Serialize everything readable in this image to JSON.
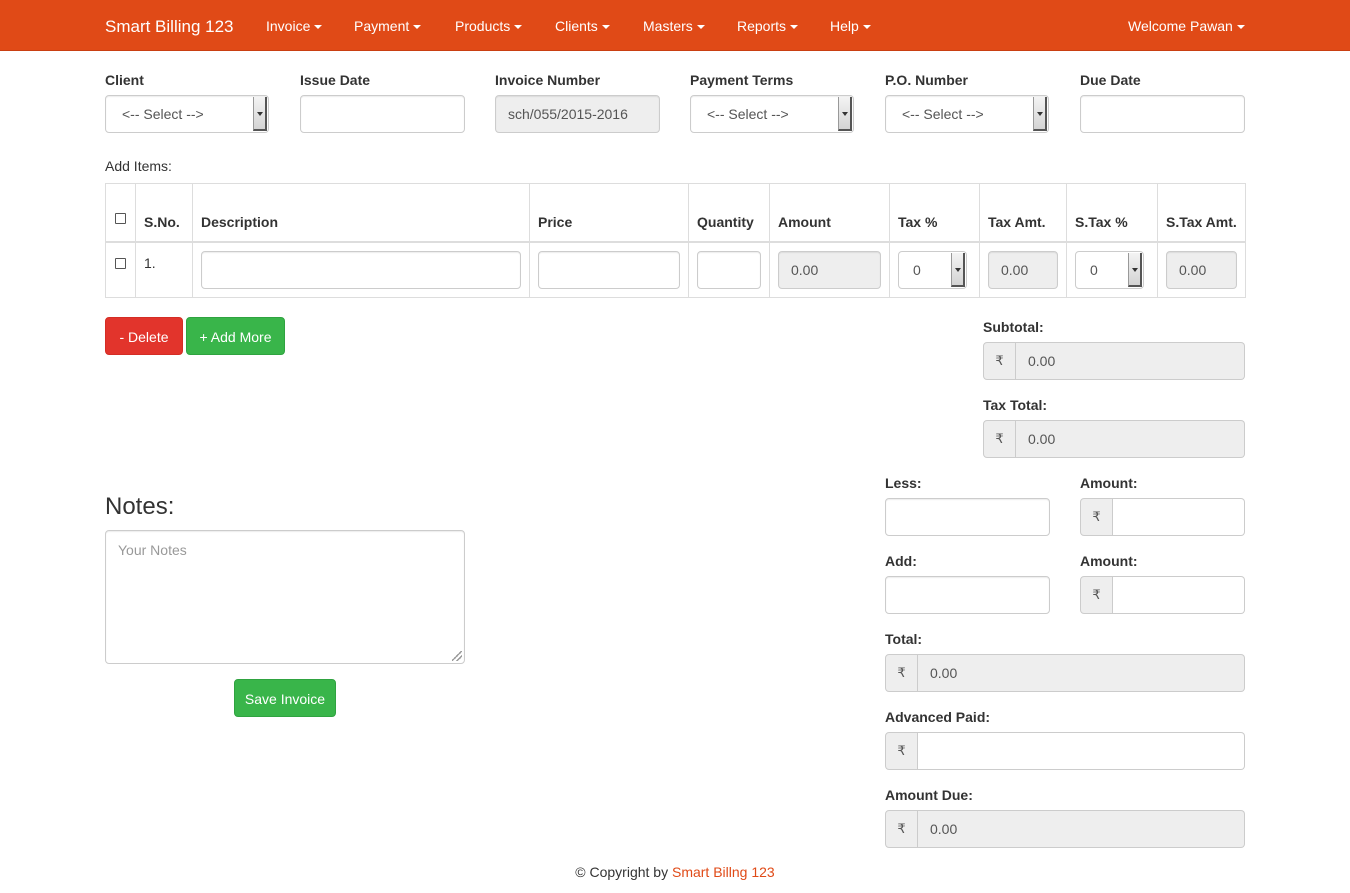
{
  "nav": {
    "brand": "Smart Billing 123",
    "menu": [
      "Invoice",
      "Payment",
      "Products",
      "Clients",
      "Masters",
      "Reports",
      "Help"
    ],
    "welcome": "Welcome Pawan"
  },
  "header_fields": {
    "client": {
      "label": "Client",
      "value": "<-- Select -->"
    },
    "issue_date": {
      "label": "Issue Date",
      "value": ""
    },
    "invoice_number": {
      "label": "Invoice Number",
      "value": "sch/055/2015-2016"
    },
    "payment_terms": {
      "label": "Payment Terms",
      "value": "<-- Select -->"
    },
    "po_number": {
      "label": "P.O. Number",
      "value": "<-- Select -->"
    },
    "due_date": {
      "label": "Due Date",
      "value": ""
    }
  },
  "items": {
    "title": "Add Items:",
    "columns": [
      "S.No.",
      "Description",
      "Price",
      "Quantity",
      "Amount",
      "Tax %",
      "Tax Amt.",
      "S.Tax %",
      "S.Tax Amt."
    ],
    "rows": [
      {
        "sno": "1.",
        "description": "",
        "price": "",
        "quantity": "",
        "amount": "0.00",
        "tax_pct": "0",
        "tax_amt": "0.00",
        "stax_pct": "0",
        "stax_amt": "0.00"
      }
    ]
  },
  "buttons": {
    "delete": "- Delete",
    "add_more": "+ Add More",
    "save": "Save Invoice"
  },
  "totals": {
    "currency_symbol": "₹",
    "subtotal": {
      "label": "Subtotal:",
      "value": "0.00"
    },
    "tax_total": {
      "label": "Tax Total:",
      "value": "0.00"
    },
    "less": {
      "label": "Less:",
      "value": ""
    },
    "less_amount": {
      "label": "Amount:",
      "value": ""
    },
    "add": {
      "label": "Add:",
      "value": ""
    },
    "add_amount": {
      "label": "Amount:",
      "value": ""
    },
    "total": {
      "label": "Total:",
      "value": "0.00"
    },
    "advanced_paid": {
      "label": "Advanced Paid:",
      "value": ""
    },
    "amount_due": {
      "label": "Amount Due:",
      "value": "0.00"
    }
  },
  "notes": {
    "title": "Notes:",
    "placeholder": "Your Notes"
  },
  "footer": {
    "prefix": "© Copyright by ",
    "link": "Smart Billng 123"
  },
  "colors": {
    "brand": "#e04a17",
    "danger": "#e2342c",
    "success": "#39b54a"
  }
}
